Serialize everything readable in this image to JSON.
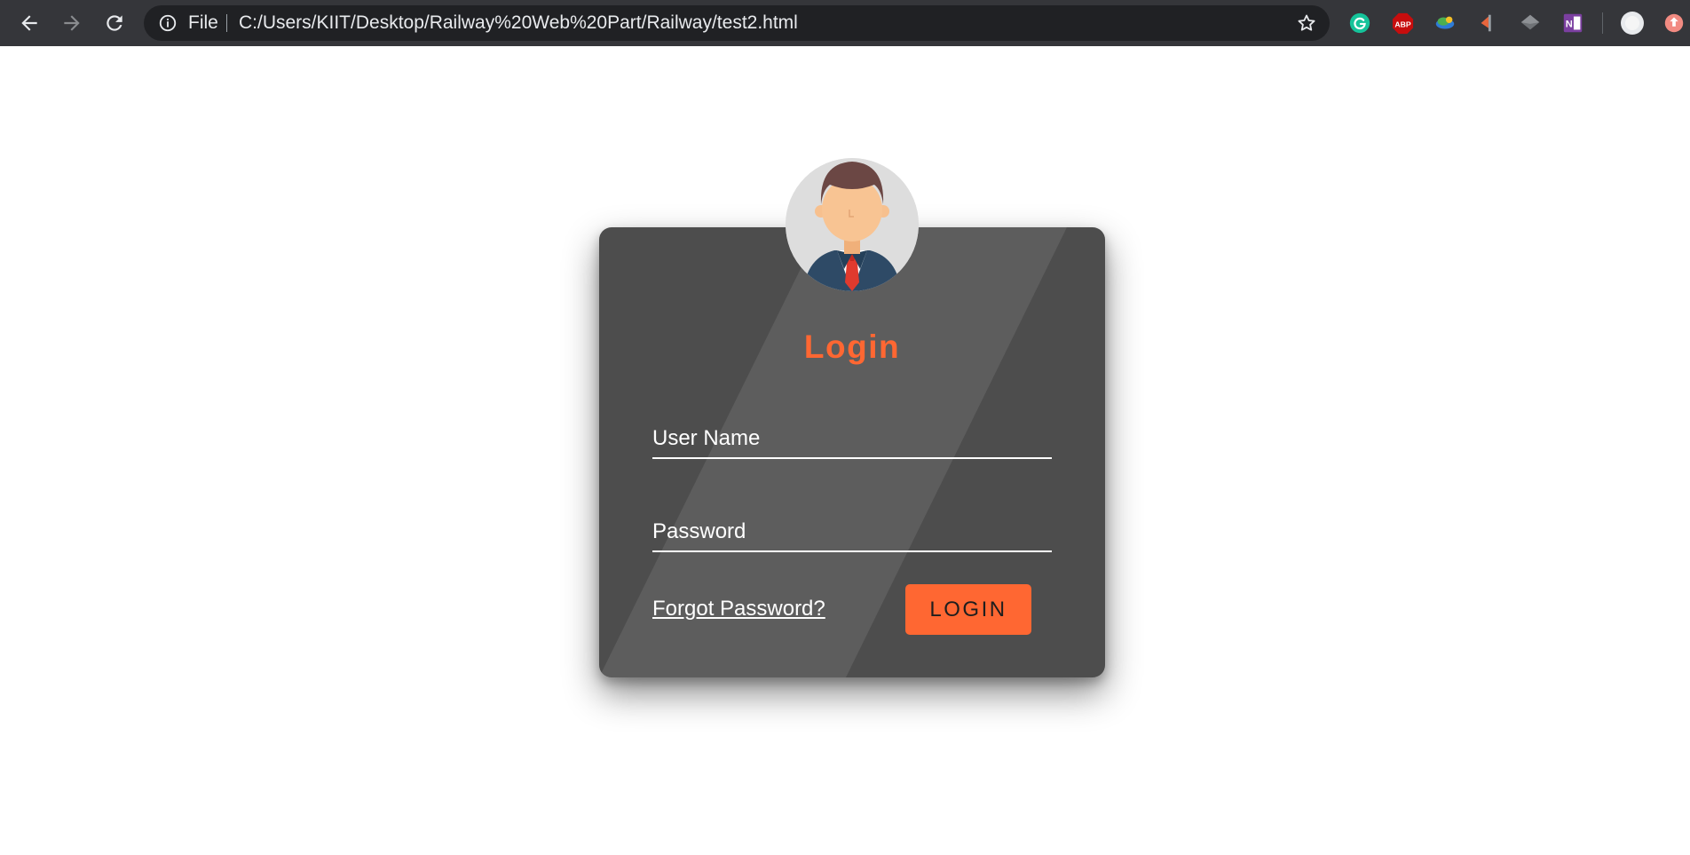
{
  "browser": {
    "protocol_label": "File",
    "url": "C:/Users/KIIT/Desktop/Railway%20Web%20Part/Railway/test2.html",
    "icons": [
      "back-arrow-icon",
      "forward-arrow-icon",
      "reload-icon",
      "info-icon",
      "star-icon"
    ],
    "extensions": [
      {
        "name": "grammarly-icon",
        "color": "#15c39a"
      },
      {
        "name": "adblock-plus-icon",
        "label": "ABP",
        "color": "#c70d0d"
      },
      {
        "name": "globe-extension-icon",
        "color": "#3a8a3a"
      },
      {
        "name": "flag-extension-icon",
        "color": "#e8663d"
      },
      {
        "name": "layers-extension-icon",
        "color": "#9aa0a6"
      },
      {
        "name": "onenote-icon",
        "label": "N",
        "color": "#7b3fa0"
      },
      {
        "name": "profile-avatar-icon",
        "color": "#e8eaed"
      },
      {
        "name": "update-icon",
        "color": "#f28b82"
      }
    ]
  },
  "login": {
    "title": "Login",
    "username_placeholder": "User Name",
    "password_placeholder": "Password",
    "forgot_label": "Forgot Password?",
    "button_label": "LOGIN",
    "accent_color": "#ff6732",
    "card_color": "#4d4d4d"
  }
}
